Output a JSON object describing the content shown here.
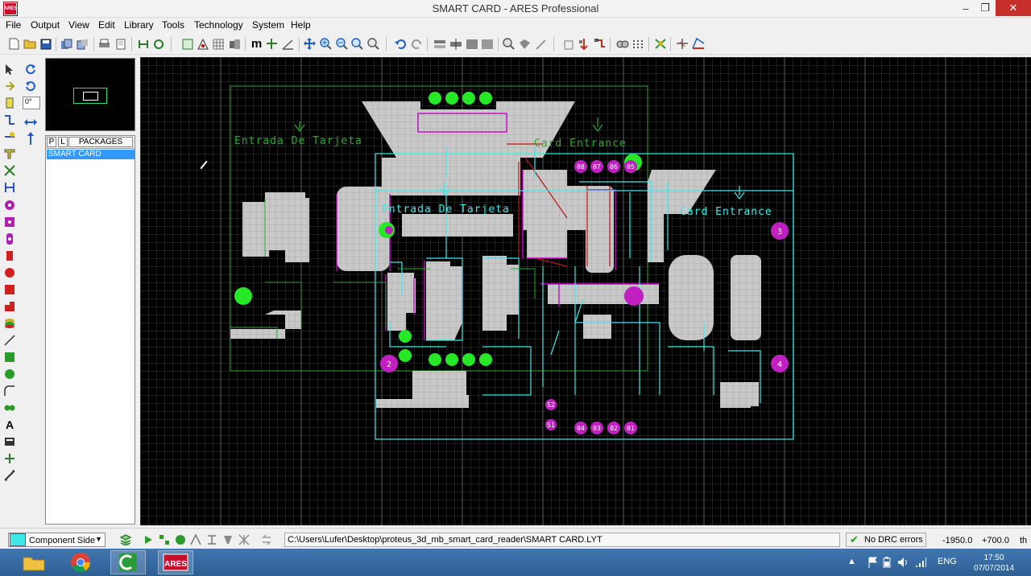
{
  "window": {
    "title": "SMART CARD - ARES Professional",
    "app_icon_label": "ARES",
    "minimize": "–",
    "maximize": "❐",
    "close": "✕"
  },
  "menu": [
    "File",
    "Output",
    "View",
    "Edit",
    "Library",
    "Tools",
    "Technology",
    "System",
    "Help"
  ],
  "toolbar": {
    "icons": [
      "new-file-icon",
      "open-folder-icon",
      "save-icon",
      "import-icon",
      "export-icon",
      "print-icon",
      "print-preview-icon",
      "netlist-icon",
      "refresh-icon",
      "grid-icon",
      "origin-icon",
      "dot-grid-icon",
      "snap-icon",
      "metric-icon",
      "cursor-cross-icon",
      "zoom-pan-icon",
      "zoom-in-icon",
      "zoom-out-icon",
      "zoom-all-icon",
      "zoom-area-icon",
      "undo-icon",
      "redo-icon",
      "block-copy-icon",
      "block-move-icon",
      "block-rotate-icon",
      "block-delete-icon",
      "pick-package-icon",
      "make-package-icon",
      "decompose-icon",
      "tidy-icon",
      "autoplace-icon",
      "autoroute-icon",
      "search-tag-icon",
      "property-icon",
      "ratsnest-icon",
      "drc-icon",
      "3d-view-icon"
    ],
    "metric_label": "m"
  },
  "left_tools": {
    "rotation_value": "0°"
  },
  "picker": {
    "tab_p": "P",
    "tab_l": "L",
    "title": "PACKAGES",
    "items": [
      "SMART CARD"
    ]
  },
  "board": {
    "labels": [
      "Entrada De Tarjeta",
      "Card Entrance",
      "Entrada De Tarjeta",
      "Card Entrance"
    ],
    "mounting_holes": [
      "3",
      "2",
      "4"
    ],
    "pad_labels_top": [
      "08",
      "07",
      "06",
      "05"
    ],
    "pad_labels_bottom": [
      "04",
      "03",
      "02",
      "01"
    ],
    "switch_labels": [
      "S2",
      "S1"
    ],
    "colors": {
      "grid": "#3a3a3a",
      "outline": "#3ce8e8",
      "silk": "#2ea82e",
      "copper": "#c8c8c8",
      "pad_green": "#26e826",
      "pad_magenta": "#c020c0",
      "track": "#d000d0"
    }
  },
  "status": {
    "layer": "Component Side",
    "path": "C:\\Users\\Lufer\\Desktop\\proteus_3d_mb_smart_card_reader\\SMART CARD.LYT",
    "drc": "No DRC errors",
    "coord_x": "-1950.0",
    "coord_y": "+700.0",
    "units": "th"
  },
  "taskbar": {
    "language": "ENG",
    "time": "17:50",
    "date": "07/07/2014"
  }
}
